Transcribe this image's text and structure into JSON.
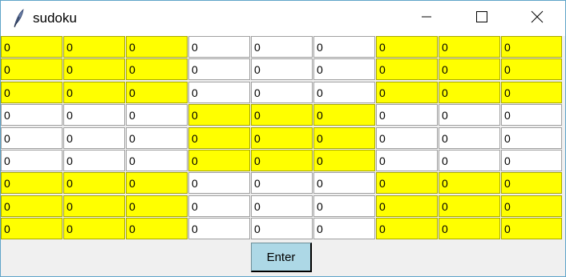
{
  "window": {
    "title": "sudoku",
    "controls": {
      "minimize_icon": "minimize-icon",
      "maximize_icon": "maximize-icon",
      "close_icon": "close-icon"
    }
  },
  "colors": {
    "highlight": "#ffff00",
    "plain": "#ffffff",
    "button": "#add8e6"
  },
  "grid": {
    "rows": [
      [
        "0",
        "0",
        "0",
        "0",
        "0",
        "0",
        "0",
        "0",
        "0"
      ],
      [
        "0",
        "0",
        "0",
        "0",
        "0",
        "0",
        "0",
        "0",
        "0"
      ],
      [
        "0",
        "0",
        "0",
        "0",
        "0",
        "0",
        "0",
        "0",
        "0"
      ],
      [
        "0",
        "0",
        "0",
        "0",
        "0",
        "0",
        "0",
        "0",
        "0"
      ],
      [
        "0",
        "0",
        "0",
        "0",
        "0",
        "0",
        "0",
        "0",
        "0"
      ],
      [
        "0",
        "0",
        "0",
        "0",
        "0",
        "0",
        "0",
        "0",
        "0"
      ],
      [
        "0",
        "0",
        "0",
        "0",
        "0",
        "0",
        "0",
        "0",
        "0"
      ],
      [
        "0",
        "0",
        "0",
        "0",
        "0",
        "0",
        "0",
        "0",
        "0"
      ],
      [
        "0",
        "0",
        "0",
        "0",
        "0",
        "0",
        "0",
        "0",
        "0"
      ]
    ]
  },
  "enter_button": {
    "label": "Enter"
  }
}
